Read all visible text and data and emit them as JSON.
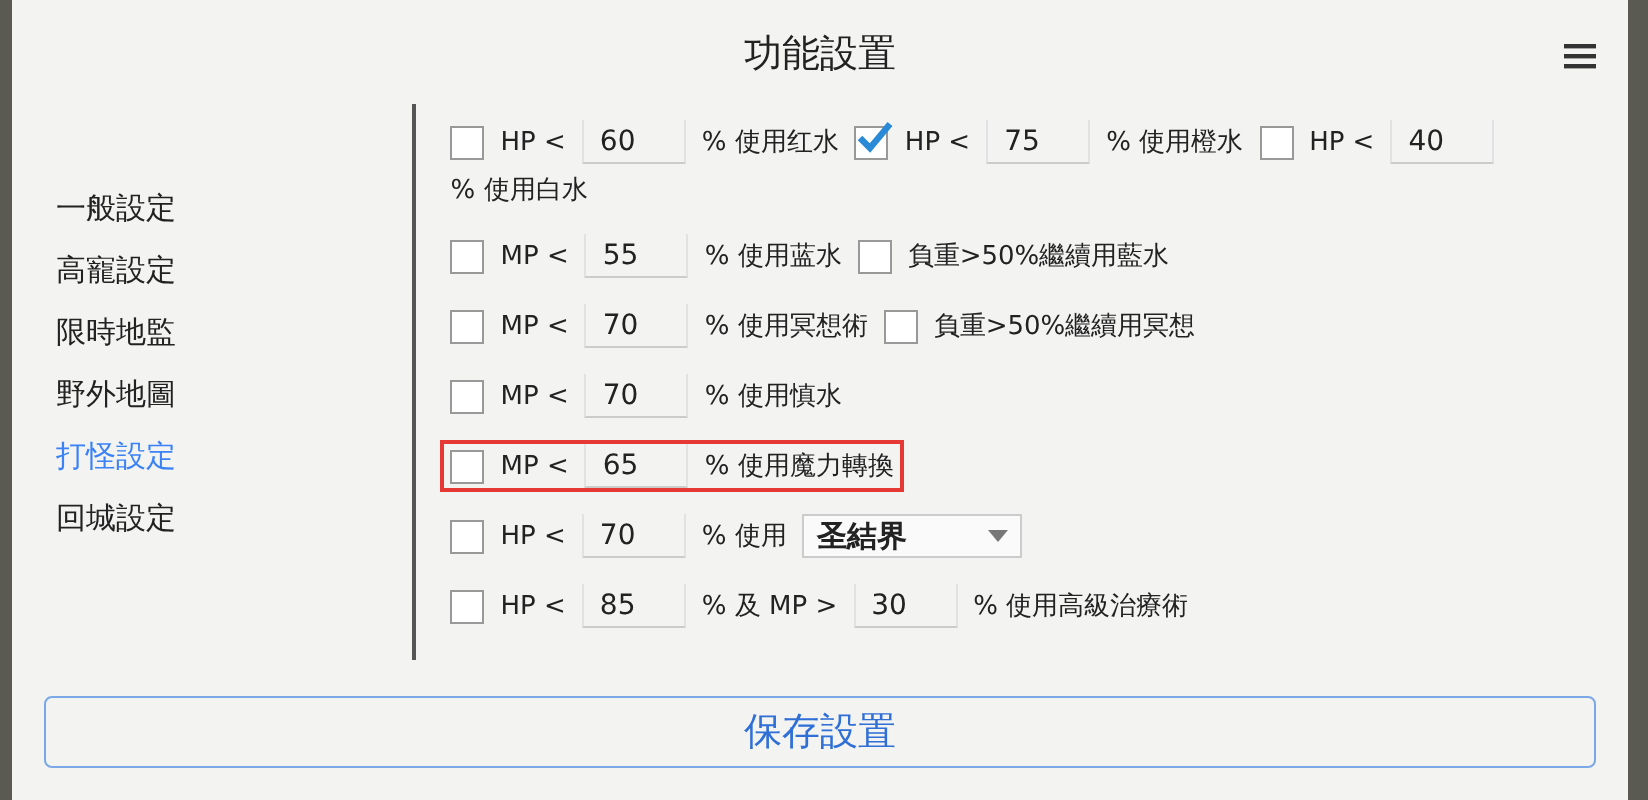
{
  "title": "功能設置",
  "sidebar": {
    "items": [
      {
        "label": "一般設定",
        "selected": false
      },
      {
        "label": "高寵設定",
        "selected": false
      },
      {
        "label": "限時地監",
        "selected": false
      },
      {
        "label": "野外地圖",
        "selected": false
      },
      {
        "label": "打怪設定",
        "selected": true
      },
      {
        "label": "回城設定",
        "selected": false
      }
    ]
  },
  "rows": [
    {
      "highlighted": false,
      "parts": [
        {
          "kind": "check",
          "checked": false
        },
        {
          "kind": "text",
          "text": "HP <"
        },
        {
          "kind": "field",
          "value": "60"
        },
        {
          "kind": "text",
          "text": "% 使用红水"
        },
        {
          "kind": "check",
          "checked": true
        },
        {
          "kind": "text",
          "text": "HP <"
        },
        {
          "kind": "field",
          "value": "75"
        },
        {
          "kind": "text",
          "text": "% 使用橙水"
        },
        {
          "kind": "check",
          "checked": false
        },
        {
          "kind": "text",
          "text": "HP <"
        },
        {
          "kind": "field",
          "value": "40"
        },
        {
          "kind": "text",
          "text": "% 使用白水"
        }
      ]
    },
    {
      "highlighted": false,
      "parts": [
        {
          "kind": "check",
          "checked": false
        },
        {
          "kind": "text",
          "text": "MP <"
        },
        {
          "kind": "field",
          "value": "55"
        },
        {
          "kind": "text",
          "text": "% 使用蓝水"
        },
        {
          "kind": "check",
          "checked": false
        },
        {
          "kind": "text",
          "text": "負重>50%繼續用藍水"
        }
      ]
    },
    {
      "highlighted": false,
      "parts": [
        {
          "kind": "check",
          "checked": false
        },
        {
          "kind": "text",
          "text": "MP <"
        },
        {
          "kind": "field",
          "value": "70"
        },
        {
          "kind": "text",
          "text": "% 使用冥想術"
        },
        {
          "kind": "check",
          "checked": false
        },
        {
          "kind": "text",
          "text": "負重>50%繼續用冥想"
        }
      ]
    },
    {
      "highlighted": false,
      "parts": [
        {
          "kind": "check",
          "checked": false
        },
        {
          "kind": "text",
          "text": "MP <"
        },
        {
          "kind": "field",
          "value": "70"
        },
        {
          "kind": "text",
          "text": "% 使用慎水"
        }
      ]
    },
    {
      "highlighted": true,
      "parts": [
        {
          "kind": "check",
          "checked": false
        },
        {
          "kind": "text",
          "text": "MP <"
        },
        {
          "kind": "field",
          "value": "65"
        },
        {
          "kind": "text",
          "text": "% 使用魔力轉換"
        }
      ]
    },
    {
      "highlighted": false,
      "parts": [
        {
          "kind": "check",
          "checked": false
        },
        {
          "kind": "text",
          "text": "HP <"
        },
        {
          "kind": "field",
          "value": "70"
        },
        {
          "kind": "text",
          "text": "% 使用"
        },
        {
          "kind": "select",
          "value": "圣結界"
        }
      ]
    },
    {
      "highlighted": false,
      "parts": [
        {
          "kind": "check",
          "checked": false
        },
        {
          "kind": "text",
          "text": "HP <"
        },
        {
          "kind": "field",
          "value": "85"
        },
        {
          "kind": "text",
          "text": "% 及 MP >"
        },
        {
          "kind": "field",
          "value": "30"
        },
        {
          "kind": "text",
          "text": "% 使用高級治療術"
        }
      ]
    }
  ],
  "save_button": "保存設置"
}
